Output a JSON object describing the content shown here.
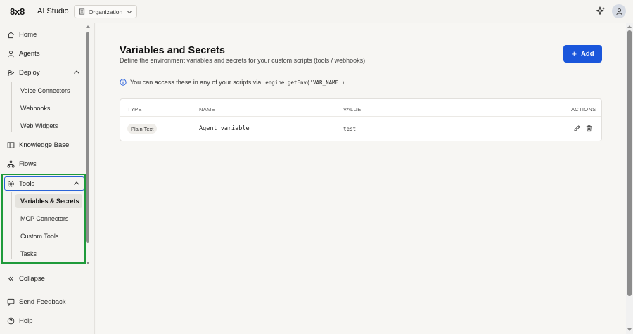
{
  "header": {
    "logo": "8x8",
    "app_title": "AI Studio",
    "org_selector": "Organization",
    "sparkle_icon": "sparkle-icon",
    "avatar_icon": "user-icon"
  },
  "sidebar": {
    "home": "Home",
    "agents": "Agents",
    "deploy": "Deploy",
    "deploy_items": [
      "Voice Connectors",
      "Webhooks",
      "Web Widgets"
    ],
    "knowledge_base": "Knowledge Base",
    "flows": "Flows",
    "tools": "Tools",
    "tools_items": [
      "Variables & Secrets",
      "MCP Connectors",
      "Custom Tools",
      "Tasks"
    ],
    "collapse": "Collapse",
    "send_feedback": "Send Feedback",
    "help": "Help"
  },
  "main": {
    "title": "Variables and Secrets",
    "subtitle": "Define the environment variables and secrets for your custom scripts (tools / webhooks)",
    "add_label": "Add",
    "info_text": "You can access these in any of your scripts via",
    "info_code": "engine.getEnv('VAR_NAME')",
    "table": {
      "headers": {
        "type": "TYPE",
        "name": "NAME",
        "value": "VALUE",
        "actions": "ACTIONS"
      },
      "rows": [
        {
          "type": "Plain Text",
          "name": "Agent_variable",
          "value": "test"
        }
      ]
    }
  },
  "colors": {
    "accent": "#1a56db",
    "highlight_box": "#1e9a3a",
    "focus_ring": "#2a64d8"
  }
}
